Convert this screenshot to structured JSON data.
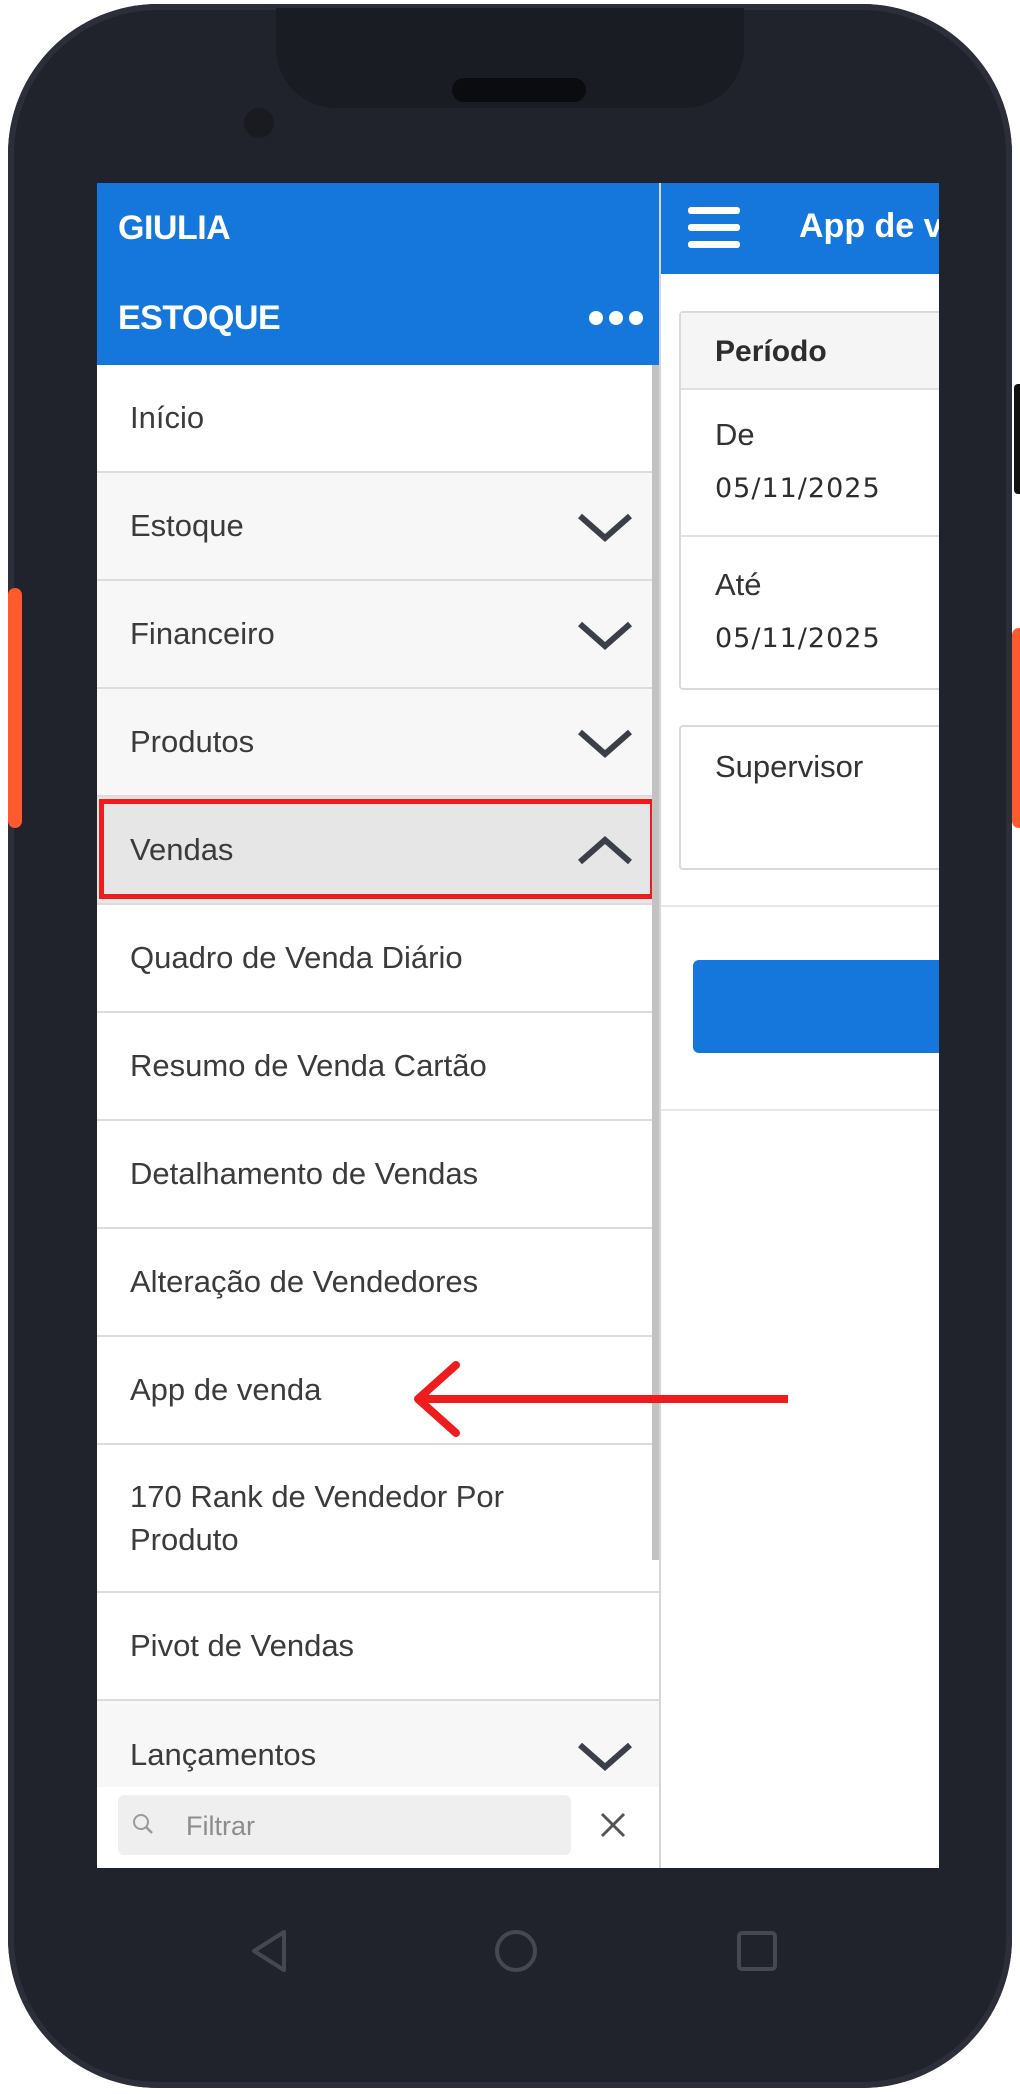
{
  "drawer": {
    "user": "GIULIA",
    "company": "ESTOQUE",
    "menu": [
      {
        "label": "Início",
        "type": "plain"
      },
      {
        "label": "Estoque",
        "type": "group",
        "expanded": false
      },
      {
        "label": "Financeiro",
        "type": "group",
        "expanded": false
      },
      {
        "label": "Produtos",
        "type": "group",
        "expanded": false
      },
      {
        "label": "Vendas",
        "type": "group",
        "expanded": true
      },
      {
        "label": "Quadro de Venda Diário",
        "type": "sub"
      },
      {
        "label": "Resumo de Venda Cartão",
        "type": "sub"
      },
      {
        "label": "Detalhamento de Vendas",
        "type": "sub"
      },
      {
        "label": "Alteração de Vendedores",
        "type": "sub"
      },
      {
        "label": "App de venda",
        "type": "sub"
      },
      {
        "label": "170 Rank de Vendedor Por Produto",
        "type": "sub"
      },
      {
        "label": "Pivot de Vendas",
        "type": "sub"
      },
      {
        "label": "Lançamentos",
        "type": "group",
        "expanded": false
      }
    ],
    "filter_placeholder": "Filtrar"
  },
  "main": {
    "title": "App de venda",
    "period": {
      "title": "Período",
      "from_label": "De",
      "from_value": "05/11/2025",
      "to_label": "Até",
      "to_value": "05/11/2025"
    },
    "supervisor_label": "Supervisor"
  },
  "colors": {
    "accent": "#1577db",
    "highlight": "#ee1c1c",
    "device_frame": "#21232c",
    "side_button": "#ff5a2d"
  }
}
